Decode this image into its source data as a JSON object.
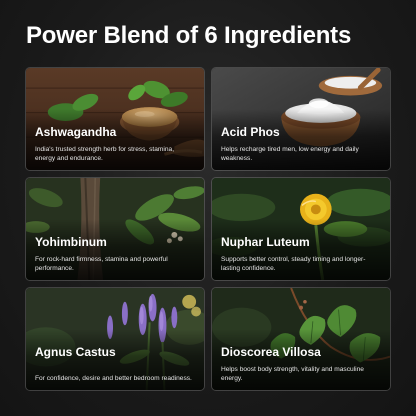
{
  "title": "Power Blend of 6 Ingredients",
  "ingredients": [
    {
      "name": "Ashwagandha",
      "description": "India's trusted strength herb for stress, stamina, energy and endurance.",
      "image": "ashwagandha-powder-bowl"
    },
    {
      "name": "Acid Phos",
      "description": "Helps recharge tired men, low energy and daily weakness.",
      "image": "white-powder-wooden-bowl"
    },
    {
      "name": "Yohimbinum",
      "description": "For rock-hard firmness, stamina and powerful performance.",
      "image": "yohimbe-tree-leaves"
    },
    {
      "name": "Nuphar Luteum",
      "description": "Supports better control, steady timing and longer-lasting confidence.",
      "image": "yellow-water-lily"
    },
    {
      "name": "Agnus Castus",
      "description": "For confidence, desire and better bedroom readiness.",
      "image": "purple-flower-spikes"
    },
    {
      "name": "Dioscorea Villosa",
      "description": "Helps boost body strength, vitality and masculine energy.",
      "image": "heart-shaped-vine-leaves"
    }
  ]
}
